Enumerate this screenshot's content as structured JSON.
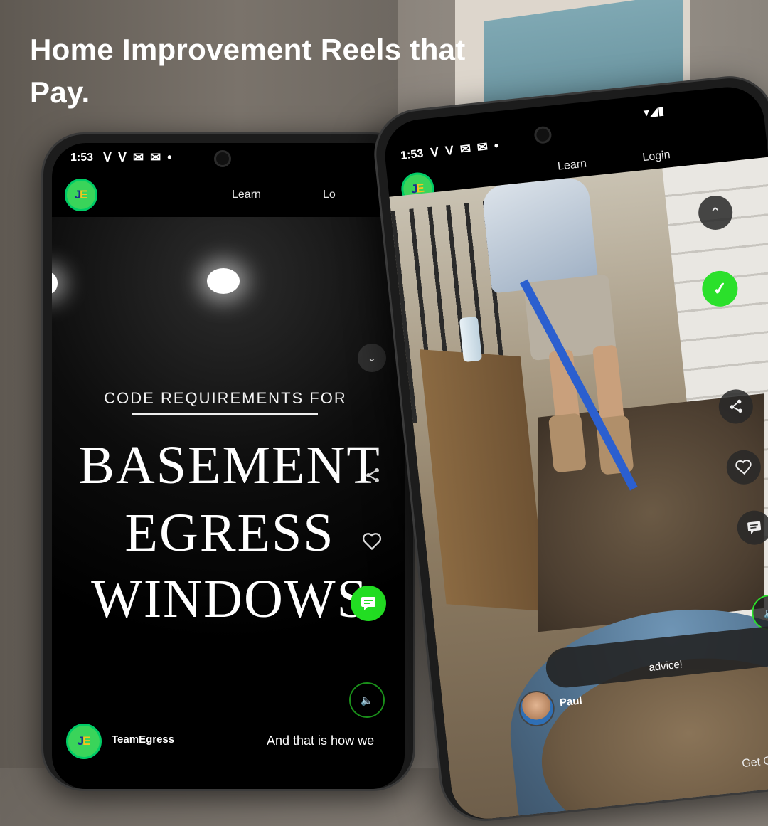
{
  "headline": "Home Improvement Reels that Pay.",
  "phone_left": {
    "status": {
      "time": "1:53",
      "icons": "V V ✉ ✉ •"
    },
    "header": {
      "logo_text_1": "J",
      "logo_text_2": "E",
      "nav_learn": "Learn",
      "nav_login": "Lo"
    },
    "video": {
      "subtitle": "CODE REQUIREMENTS FOR",
      "line1": "BASEMENT",
      "line2": "EGRESS",
      "line3": "WINDOWS"
    },
    "footer": {
      "username": "TeamEgress",
      "caption": "And that is how we"
    },
    "accent_color": "#22dd22"
  },
  "phone_right": {
    "status": {
      "time": "1:53",
      "icons": "V V ✉ ✉ •"
    },
    "header": {
      "nav_learn": "Learn",
      "nav_login": "Login"
    },
    "comment": {
      "name": "Paul",
      "text": "advice!"
    },
    "footer": {
      "cta": "Get Quote"
    }
  }
}
